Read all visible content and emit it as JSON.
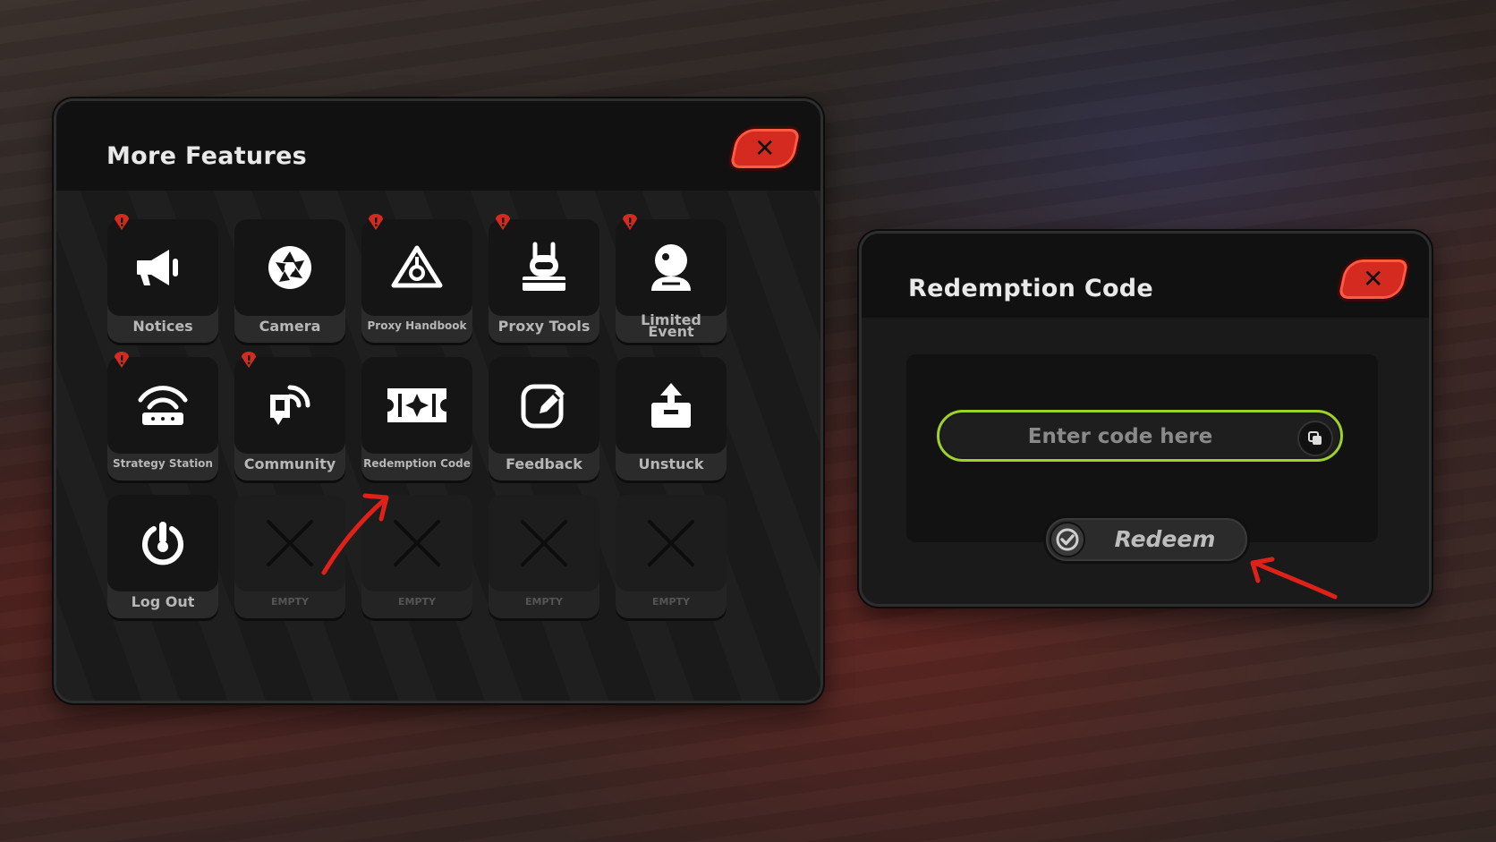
{
  "more_features": {
    "title": "More Features",
    "close_icon": "close-icon",
    "tiles": [
      {
        "label": "Notices",
        "icon": "megaphone-icon",
        "alert": true
      },
      {
        "label": "Camera",
        "icon": "camera-aperture-icon",
        "alert": false
      },
      {
        "label": "Proxy Handbook",
        "icon": "proxy-handbook-icon",
        "alert": true
      },
      {
        "label": "Proxy Tools",
        "icon": "bangboo-icon",
        "alert": true
      },
      {
        "label": "Limited Event",
        "icon": "limited-event-icon",
        "alert": true
      },
      {
        "label": "Strategy Station",
        "icon": "strategy-station-icon",
        "alert": true
      },
      {
        "label": "Community",
        "icon": "community-icon",
        "alert": true
      },
      {
        "label": "Redemption Code",
        "icon": "ticket-icon",
        "alert": false
      },
      {
        "label": "Feedback",
        "icon": "feedback-edit-icon",
        "alert": false
      },
      {
        "label": "Unstuck",
        "icon": "unstuck-icon",
        "alert": false
      },
      {
        "label": "Log Out",
        "icon": "power-icon",
        "alert": false
      },
      {
        "label": "EMPTY",
        "icon": "empty-x-icon",
        "alert": false
      },
      {
        "label": "EMPTY",
        "icon": "empty-x-icon",
        "alert": false
      },
      {
        "label": "EMPTY",
        "icon": "empty-x-icon",
        "alert": false
      },
      {
        "label": "EMPTY",
        "icon": "empty-x-icon",
        "alert": false
      }
    ]
  },
  "redemption": {
    "title": "Redemption Code",
    "input_placeholder": "Enter code here",
    "input_value": "",
    "paste_icon": "paste-icon",
    "redeem_label": "Redeem",
    "redeem_icon": "checkmark-icon"
  },
  "colors": {
    "accent_red": "#d42a1f",
    "input_border_green": "#9ed22a",
    "annotation_arrow": "#e0211a"
  }
}
